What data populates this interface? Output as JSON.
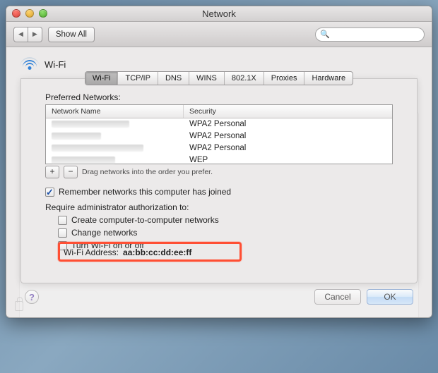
{
  "window": {
    "title": "Network"
  },
  "toolbar": {
    "show_all": "Show All",
    "search_placeholder": ""
  },
  "header": {
    "wifi_label": "Wi-Fi"
  },
  "tabs": {
    "items": [
      {
        "label": "Wi-Fi",
        "active": true
      },
      {
        "label": "TCP/IP"
      },
      {
        "label": "DNS"
      },
      {
        "label": "WINS"
      },
      {
        "label": "802.1X"
      },
      {
        "label": "Proxies"
      },
      {
        "label": "Hardware"
      }
    ]
  },
  "preferred": {
    "title": "Preferred Networks:",
    "columns": {
      "name": "Network Name",
      "security": "Security"
    },
    "rows": [
      {
        "security": "WPA2 Personal"
      },
      {
        "security": "WPA2 Personal"
      },
      {
        "security": "WPA2 Personal"
      },
      {
        "security": "WEP"
      }
    ],
    "hint": "Drag networks into the order you prefer."
  },
  "options": {
    "remember": "Remember networks this computer has joined",
    "require_label": "Require administrator authorization to:",
    "create": "Create computer-to-computer networks",
    "change": "Change networks",
    "toggle": "Turn Wi-Fi on or off"
  },
  "address": {
    "label": "Wi-Fi Address:",
    "value": "aa:bb:cc:dd:ee:ff"
  },
  "buttons": {
    "cancel": "Cancel",
    "ok": "OK"
  }
}
